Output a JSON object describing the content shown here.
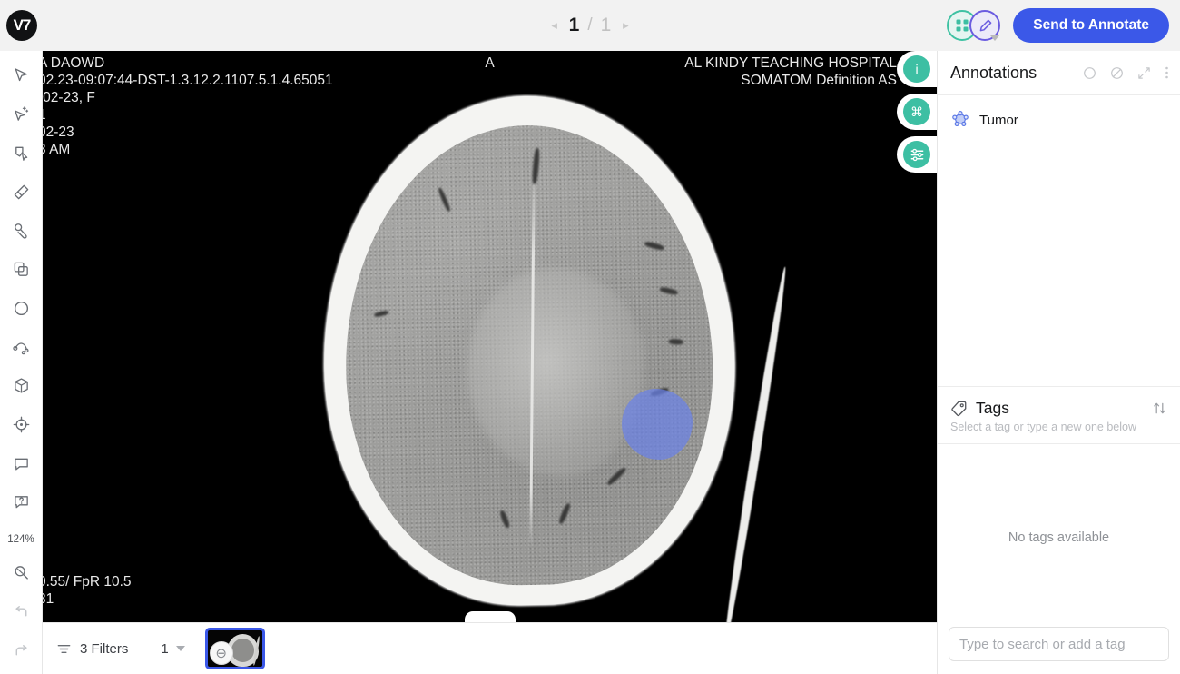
{
  "app": {
    "logo_text": "V7"
  },
  "topbar": {
    "pager": {
      "prev_icon": "chevron-left-icon",
      "current": "1",
      "separator": "/",
      "total": "1",
      "next_icon": "chevron-right-icon"
    },
    "avatars": [
      {
        "name": "grid-avatar",
        "glyph": "▦",
        "color": "#3fc2a3"
      },
      {
        "name": "pencil-avatar",
        "glyph": "✎",
        "color": "#6b5ce0"
      }
    ],
    "send_button": "Send to Annotate"
  },
  "toolbar": {
    "tools": [
      {
        "name": "select-tool",
        "icon": "cursor-arrow-icon"
      },
      {
        "name": "auto-annotate-tool",
        "icon": "magic-cursor-icon"
      },
      {
        "name": "polygon-tool",
        "icon": "polygon-cursor-icon"
      },
      {
        "name": "brush-tool",
        "icon": "brush-icon"
      },
      {
        "name": "pen-tool",
        "icon": "pen-icon"
      },
      {
        "name": "bounding-box-tool",
        "icon": "copy-squares-icon"
      },
      {
        "name": "ellipse-tool",
        "icon": "circle-icon"
      },
      {
        "name": "keypoint-skeleton-tool",
        "icon": "skeleton-icon"
      },
      {
        "name": "cuboid-tool",
        "icon": "cube-icon"
      },
      {
        "name": "keypoint-tool",
        "icon": "crosshair-icon"
      },
      {
        "name": "comment-tool",
        "icon": "comment-icon"
      },
      {
        "name": "help-tool",
        "icon": "question-bubble-icon"
      }
    ],
    "zoom_level": "124%",
    "bottom_tools": [
      {
        "name": "zoom-tool",
        "icon": "magnifier-icon"
      },
      {
        "name": "undo-tool",
        "icon": "undo-arrow-icon"
      },
      {
        "name": "redo-tool",
        "icon": "redo-arrow-icon"
      }
    ]
  },
  "canvas": {
    "dicom_overlay": {
      "top_left": "A DAOWD\n02.23-09:07:44-DST-1.3.12.2.1107.5.1.4.65051\n-02-23, F\n1\n02-23\n3 AM",
      "top_right": "AL KINDY TEACHING HOSPITAL\nSOMATOM Definition AS",
      "orientation_marker": "A",
      "bottom_left": "0.55/ FpR 10.5\n31"
    },
    "float_buttons": [
      {
        "name": "info-button",
        "glyph": "i"
      },
      {
        "name": "shortcuts-button",
        "glyph": "⌘"
      },
      {
        "name": "windowing-button",
        "glyph": "☷"
      }
    ],
    "annotation_mask": {
      "name": "tumor-mask",
      "color": "#6b82e8"
    },
    "bottom_tab": "collapse-handle"
  },
  "bottombar": {
    "filters_label": "3 Filters",
    "filters_icon": "filter-lines-icon",
    "frame_number": "1",
    "frame_caret": "chevron-down-icon",
    "thumbnail": {
      "name": "slice-thumbnail",
      "badge_glyph": "⊖"
    }
  },
  "rightpanel": {
    "annotations": {
      "title": "Annotations",
      "header_icons": [
        {
          "name": "select-all-circle-icon",
          "glyph": "○"
        },
        {
          "name": "hide-all-icon",
          "glyph": "⌀"
        },
        {
          "name": "expand-icon",
          "glyph": "⤡"
        },
        {
          "name": "more-options-icon",
          "glyph": "⋮"
        }
      ],
      "items": [
        {
          "label": "Tumor",
          "icon": "polygon-keypoint-icon",
          "color": "#6b82e8"
        }
      ]
    },
    "tags": {
      "title": "Tags",
      "icon": "tag-icon",
      "sort_icon": "sort-arrows-icon",
      "subtitle": "Select a tag or type a new one below",
      "empty_message": "No tags available",
      "input_placeholder": "Type to search or add a tag",
      "input_value": ""
    }
  },
  "colors": {
    "accent_blue": "#3b58e8",
    "teal": "#3dbfa3",
    "annotation": "#6b82e8",
    "topbar_bg": "#f2f2f2"
  }
}
